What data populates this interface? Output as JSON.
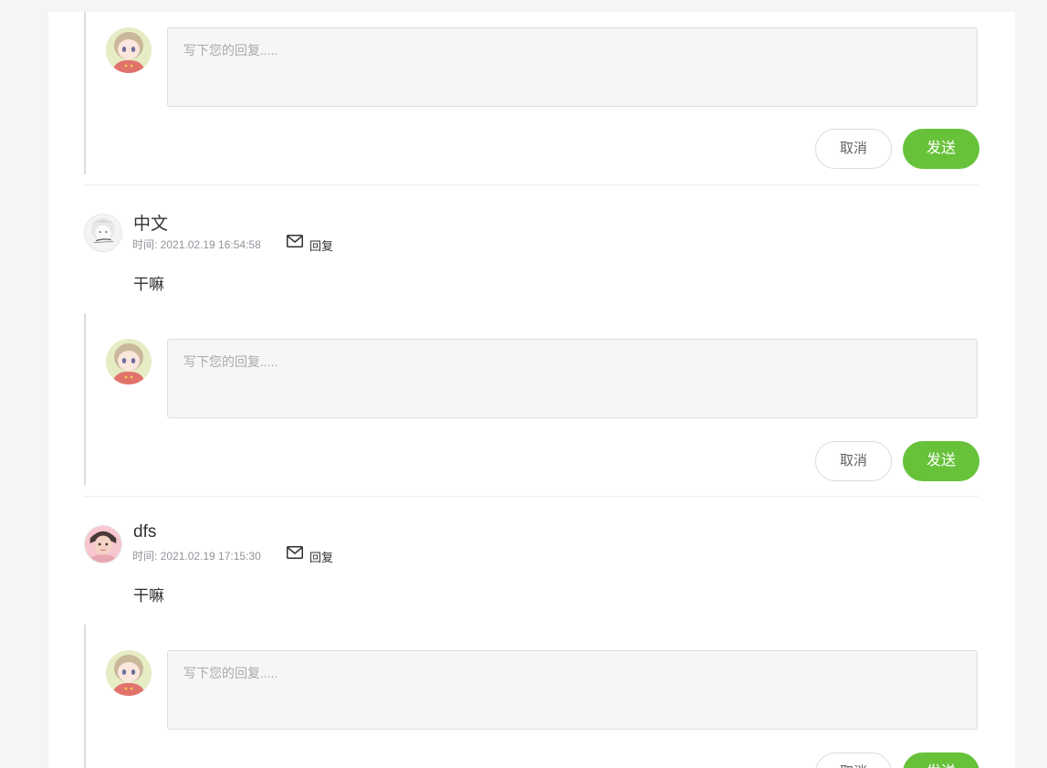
{
  "reply_form": {
    "placeholder": "写下您的回复.....",
    "cancel_label": "取消",
    "send_label": "发送"
  },
  "comments": [
    {
      "username": "中文",
      "time_label": "时间: 2021.02.19 16:54:58",
      "reply_label": "回复",
      "content": "干嘛"
    },
    {
      "username": "dfs",
      "time_label": "时间: 2021.02.19 17:15:30",
      "reply_label": "回复",
      "content": "干嘛"
    }
  ],
  "colors": {
    "accent_green": "#67c23a",
    "page_background": "#f5f5f5",
    "card_background": "#ffffff"
  },
  "icons": {
    "mail": "envelope-icon"
  }
}
